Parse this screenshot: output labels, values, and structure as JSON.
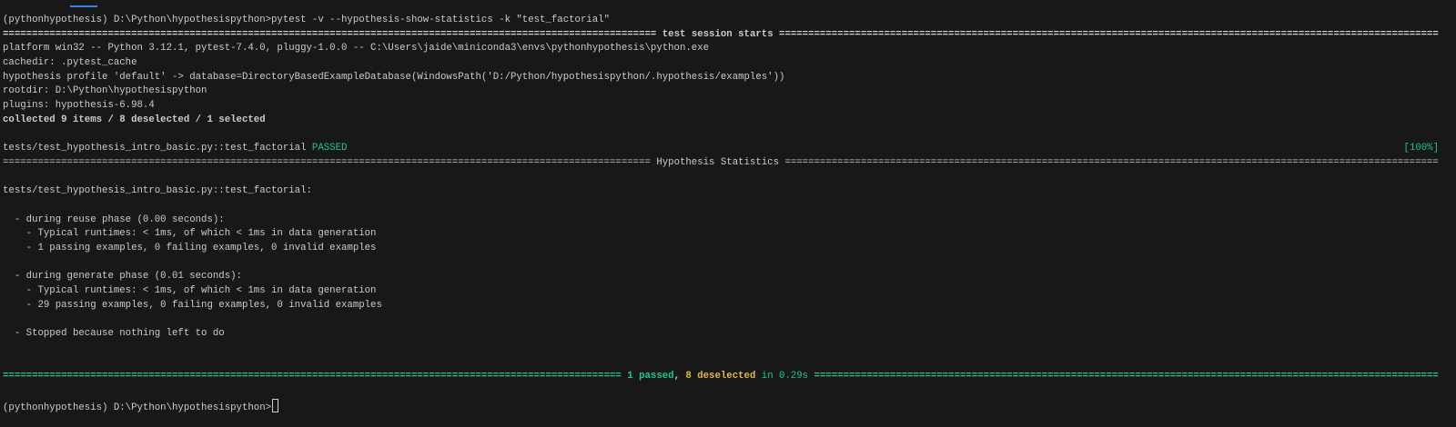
{
  "terminal": {
    "command_line": "(pythonhypothesis) D:\\Python\\hypothesispython>pytest -v --hypothesis-show-statistics -k \"test_factorial\"",
    "session_header": "test session starts",
    "platform": "platform win32 -- Python 3.12.1, pytest-7.4.0, pluggy-1.0.0 -- C:\\Users\\jaide\\miniconda3\\envs\\pythonhypothesis\\python.exe",
    "cachedir": "cachedir: .pytest_cache",
    "profile": "hypothesis profile 'default' -> database=DirectoryBasedExampleDatabase(WindowsPath('D:/Python/hypothesispython/.hypothesis/examples'))",
    "rootdir": "rootdir: D:\\Python\\hypothesispython",
    "plugins": "plugins: hypothesis-6.98.4",
    "collected": "collected 9 items / 8 deselected / 1 selected",
    "test_id": "tests/test_hypothesis_intro_basic.py::test_factorial ",
    "test_status": "PASSED",
    "test_progress": "[100%]",
    "stats_header": "Hypothesis Statistics",
    "stats_test": "tests/test_hypothesis_intro_basic.py::test_factorial:",
    "reuse_phase": "  - during reuse phase (0.00 seconds):",
    "reuse_runtime": "    - Typical runtimes: < 1ms, of which < 1ms in data generation",
    "reuse_examples": "    - 1 passing examples, 0 failing examples, 0 invalid examples",
    "generate_phase": "  - during generate phase (0.01 seconds):",
    "generate_runtime": "    - Typical runtimes: < 1ms, of which < 1ms in data generation",
    "generate_examples": "    - 29 passing examples, 0 failing examples, 0 invalid examples",
    "stop_reason": "  - Stopped because nothing left to do",
    "summary_passed": "1 passed",
    "summary_sep": ", ",
    "summary_deselected": "8 deselected",
    "summary_time": " in 0.29s",
    "prompt": "(pythonhypothesis) D:\\Python\\hypothesispython>"
  },
  "colors": {
    "background": "#181818",
    "text": "#cccccc",
    "pass": "#23c58a",
    "deselected": "#e0b656"
  }
}
